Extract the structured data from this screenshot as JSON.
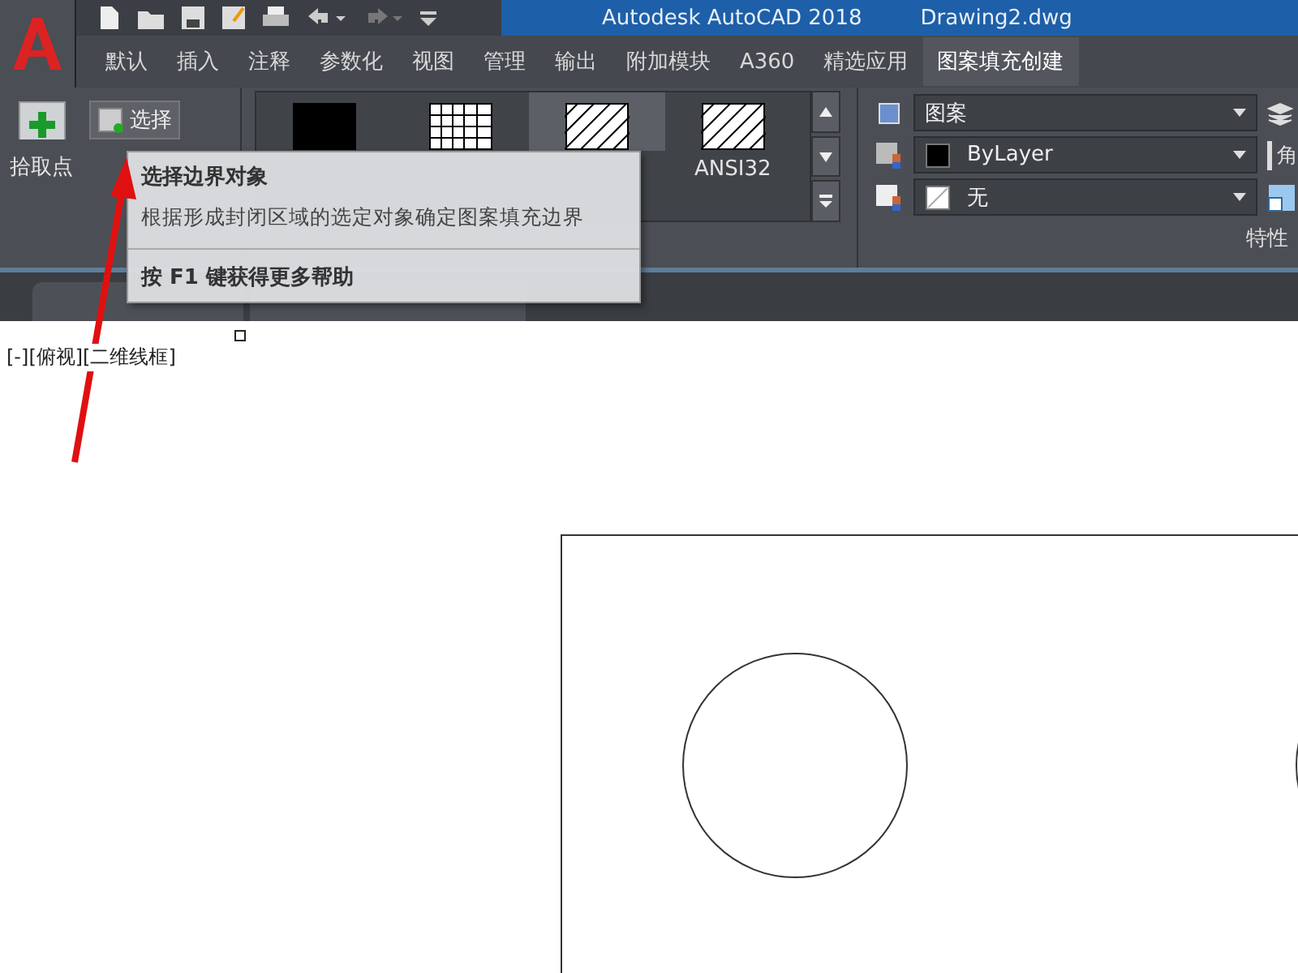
{
  "title_bar": {
    "app_title": "Autodesk AutoCAD 2018",
    "file_name": "Drawing2.dwg"
  },
  "ribbon_tabs": [
    {
      "label": "默认",
      "selected": false
    },
    {
      "label": "插入",
      "selected": false
    },
    {
      "label": "注释",
      "selected": false
    },
    {
      "label": "参数化",
      "selected": false
    },
    {
      "label": "视图",
      "selected": false
    },
    {
      "label": "管理",
      "selected": false
    },
    {
      "label": "输出",
      "selected": false
    },
    {
      "label": "附加模块",
      "selected": false
    },
    {
      "label": "A360",
      "selected": false
    },
    {
      "label": "精选应用",
      "selected": false
    },
    {
      "label": "图案填充创建",
      "selected": true
    }
  ],
  "boundary_panel": {
    "pick_points": "拾取点",
    "select": "选择"
  },
  "pattern_gallery": [
    {
      "kind": "solid",
      "selected": false
    },
    {
      "kind": "grid",
      "selected": false
    },
    {
      "kind": "hatch",
      "selected": true
    },
    {
      "kind": "hatch",
      "selected": false,
      "label": "ANSI32"
    }
  ],
  "properties_panel": {
    "hatch_type": "图案",
    "hatch_color": "ByLayer",
    "background": "无",
    "angle_label": "角",
    "panel_label": "特性"
  },
  "tooltip": {
    "title": "选择边界对象",
    "description": "根据形成封闭区域的选定对象确定图案填充边界",
    "help": "按 F1 键获得更多帮助"
  },
  "viewport": {
    "label": "[-][俯视][二维线框]"
  }
}
